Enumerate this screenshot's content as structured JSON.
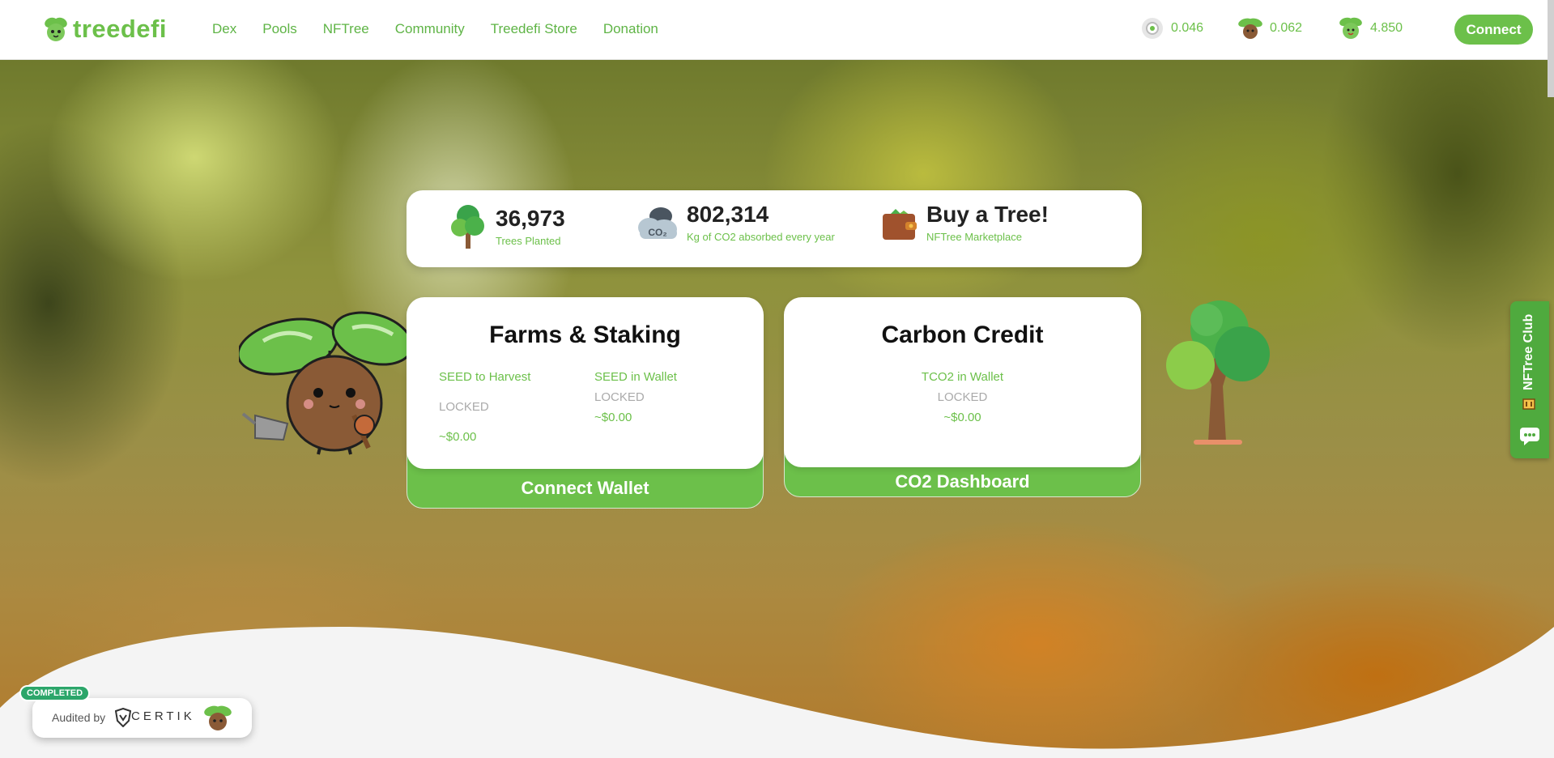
{
  "brand": {
    "name": "treedefi"
  },
  "nav": {
    "items": [
      {
        "label": "Dex"
      },
      {
        "label": "Pools"
      },
      {
        "label": "NFTree"
      },
      {
        "label": "Community"
      },
      {
        "label": "Treedefi Store"
      },
      {
        "label": "Donation"
      }
    ]
  },
  "tokens": [
    {
      "icon": "seed-token-icon",
      "value": "0.046"
    },
    {
      "icon": "tree-token-icon",
      "value": "0.062"
    },
    {
      "icon": "treedefi-token-icon",
      "value": "4.850"
    }
  ],
  "header": {
    "connect_label": "Connect"
  },
  "stats": {
    "trees": {
      "value": "36,973",
      "label": "Trees Planted"
    },
    "co2": {
      "value": "802,314",
      "label": "Kg of CO2 absorbed every year",
      "icon_text": "CO₂"
    },
    "buy": {
      "value": "Buy a Tree!",
      "label": "NFTree Marketplace"
    }
  },
  "farms": {
    "title": "Farms & Staking",
    "harvest_label": "SEED to Harvest",
    "harvest_status": "LOCKED",
    "harvest_usd": "~$0.00",
    "wallet_label": "SEED in Wallet",
    "wallet_status": "LOCKED",
    "wallet_usd": "~$0.00",
    "action": "Connect Wallet"
  },
  "carbon": {
    "title": "Carbon Credit",
    "wallet_label": "TCO2 in Wallet",
    "wallet_status": "LOCKED",
    "wallet_usd": "~$0.00",
    "action": "CO2 Dashboard"
  },
  "side_tab": {
    "label": "NFTree Club"
  },
  "audit": {
    "badge": "COMPLETED",
    "label": "Audited by",
    "auditor": "CERTIK"
  },
  "colors": {
    "accent": "#6cc04a",
    "accent_dark": "#4faa3e",
    "text_dark": "#111111"
  }
}
